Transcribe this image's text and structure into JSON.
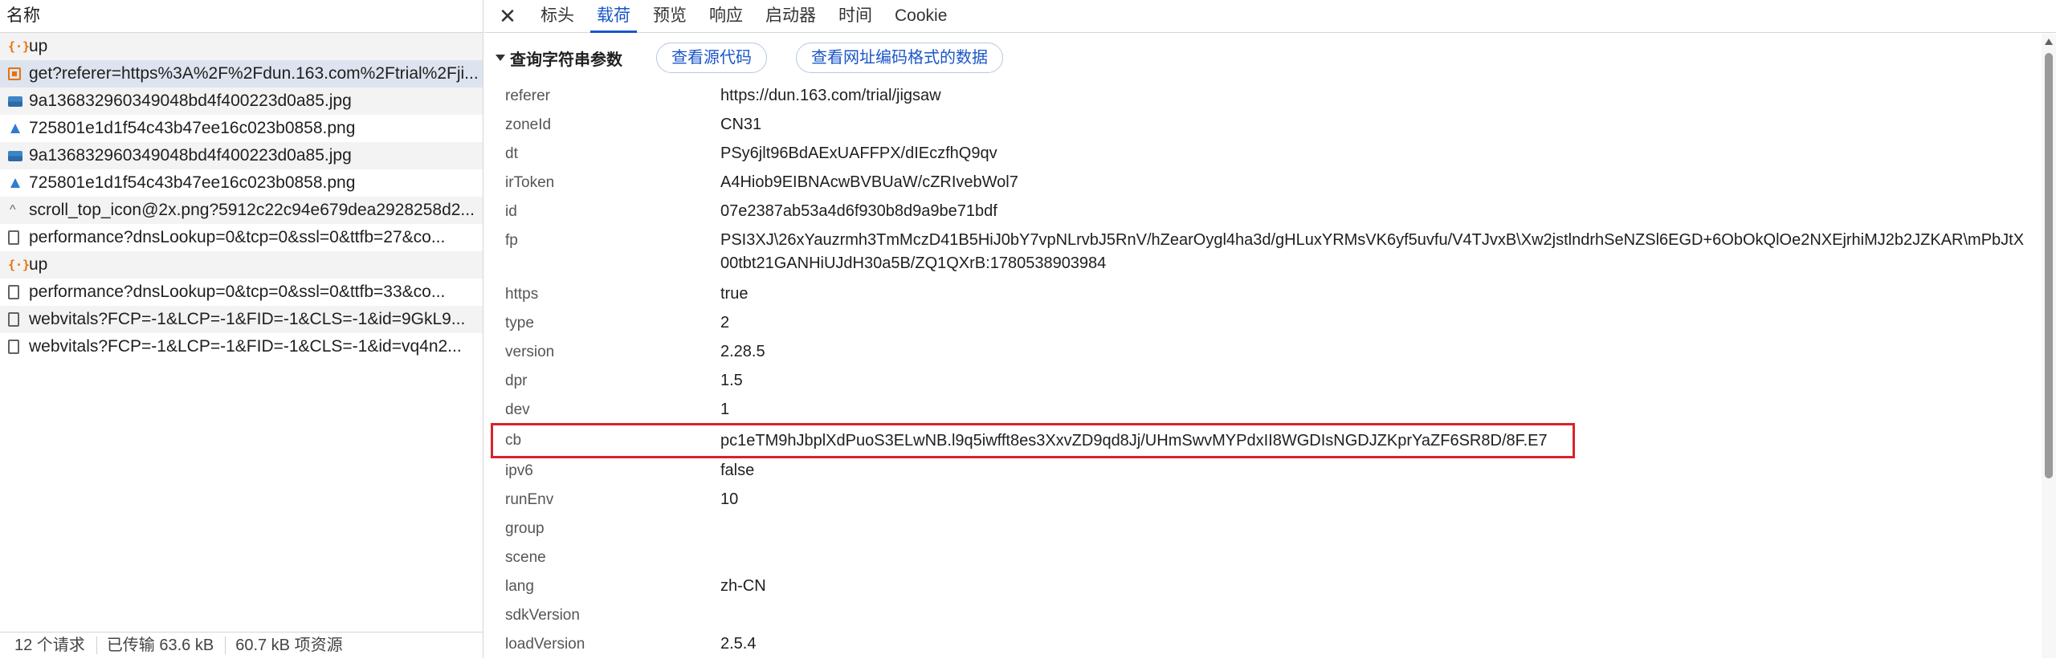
{
  "left": {
    "header": "名称",
    "requests": [
      {
        "icon": "xhr",
        "name": "up"
      },
      {
        "icon": "doc-selected",
        "name": "get?referer=https%3A%2F%2Fdun.163.com%2Ftrial%2Fji..."
      },
      {
        "icon": "jpg",
        "name": "9a136832960349048bd4f400223d0a85.jpg"
      },
      {
        "icon": "png",
        "name": "725801e1d1f54c43b47ee16c023b0858.png"
      },
      {
        "icon": "jpg",
        "name": "9a136832960349048bd4f400223d0a85.jpg"
      },
      {
        "icon": "png",
        "name": "725801e1d1f54c43b47ee16c023b0858.png"
      },
      {
        "icon": "caret",
        "name": "scroll_top_icon@2x.png?5912c22c94e679dea2928258d2..."
      },
      {
        "icon": "doc",
        "name": "performance?dnsLookup=0&tcp=0&ssl=0&ttfb=27&co..."
      },
      {
        "icon": "xhr",
        "name": "up"
      },
      {
        "icon": "doc",
        "name": "performance?dnsLookup=0&tcp=0&ssl=0&ttfb=33&co..."
      },
      {
        "icon": "doc",
        "name": "webvitals?FCP=-1&LCP=-1&FID=-1&CLS=-1&id=9GkL9..."
      },
      {
        "icon": "doc",
        "name": "webvitals?FCP=-1&LCP=-1&FID=-1&CLS=-1&id=vq4n2..."
      }
    ],
    "status": {
      "requests": "12 个请求",
      "transferred": "已传输 63.6 kB",
      "resources": "60.7 kB 项资源"
    }
  },
  "tabs": [
    "标头",
    "载荷",
    "预览",
    "响应",
    "启动器",
    "时间",
    "Cookie"
  ],
  "active_tab": "载荷",
  "section": {
    "title": "查询字符串参数",
    "view_source": "查看源代码",
    "view_url_encoded": "查看网址编码格式的数据"
  },
  "params": [
    {
      "key": "referer",
      "value": "https://dun.163.com/trial/jigsaw"
    },
    {
      "key": "zoneId",
      "value": "CN31"
    },
    {
      "key": "dt",
      "value": "PSy6jlt96BdAExUAFFPX/dIEczfhQ9qv"
    },
    {
      "key": "irToken",
      "value": "A4Hiob9EIBNAcwBVBUaW/cZRIvebWol7"
    },
    {
      "key": "id",
      "value": "07e2387ab53a4d6f930b8d9a9be71bdf"
    },
    {
      "key": "fp",
      "value": "PSI3XJ\\26xYauzrmh3TmMczD41B5HiJ0bY7vpNLrvbJ5RnV/hZearOygl4ha3d/gHLuxYRMsVK6yf5uvfu/V4TJvxB\\Xw2jstlndrhSeNZSl6EGD+6ObOkQlOe2NXEjrhiMJ2b2JZKAR\\mPbJtX00tbt21GANHiUJdH30a5B/ZQ1QXrB:1780538903984"
    },
    {
      "key": "https",
      "value": "true"
    },
    {
      "key": "type",
      "value": "2"
    },
    {
      "key": "version",
      "value": "2.28.5"
    },
    {
      "key": "dpr",
      "value": "1.5"
    },
    {
      "key": "dev",
      "value": "1"
    },
    {
      "key": "cb",
      "value": "pc1eTM9hJbplXdPuoS3ELwNB.l9q5iwfft8es3XxvZD9qd8Jj/UHmSwvMYPdxII8WGDIsNGDJZKprYaZF6SR8D/8F.E7"
    },
    {
      "key": "ipv6",
      "value": "false"
    },
    {
      "key": "runEnv",
      "value": "10"
    },
    {
      "key": "group",
      "value": ""
    },
    {
      "key": "scene",
      "value": ""
    },
    {
      "key": "lang",
      "value": "zh-CN"
    },
    {
      "key": "sdkVersion",
      "value": ""
    },
    {
      "key": "loadVersion",
      "value": "2.5.4"
    }
  ],
  "colors": {
    "accent": "#1a56c9",
    "highlight_border": "#d8232a",
    "xhr_icon": "#e8710a"
  }
}
